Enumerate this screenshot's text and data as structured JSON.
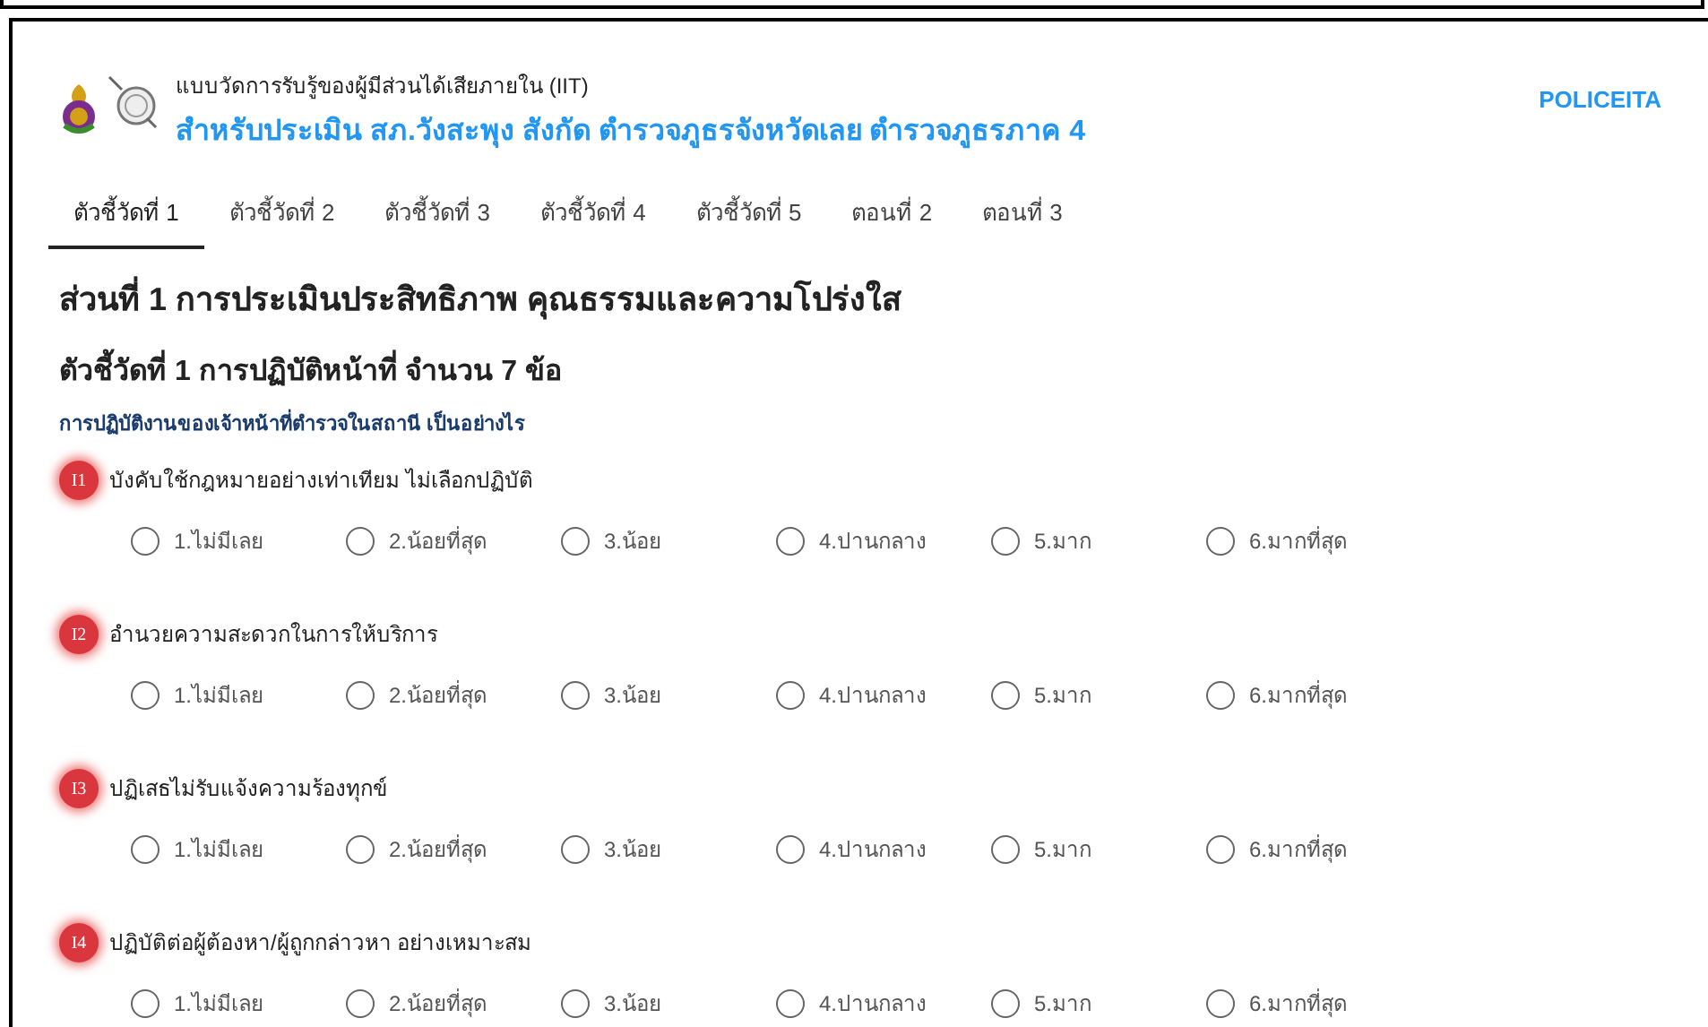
{
  "header": {
    "subtitle": "แบบวัดการรับรู้ของผู้มีส่วนได้เสียภายใน (IIT)",
    "title": "สำหรับประเมิน สภ.วังสะพุง สังกัด ตำรวจภูธรจังหวัดเลย ตำรวจภูธรภาค 4",
    "brand": "POLICEITA"
  },
  "tabs": [
    {
      "label": "ตัวชี้วัดที่ 1",
      "selected": true
    },
    {
      "label": "ตัวชี้วัดที่ 2",
      "selected": false
    },
    {
      "label": "ตัวชี้วัดที่ 3",
      "selected": false
    },
    {
      "label": "ตัวชี้วัดที่ 4",
      "selected": false
    },
    {
      "label": "ตัวชี้วัดที่ 5",
      "selected": false
    },
    {
      "label": "ตอนที่ 2",
      "selected": false
    },
    {
      "label": "ตอนที่ 3",
      "selected": false
    }
  ],
  "section_title": "ส่วนที่ 1 การประเมินประสิทธิภาพ คุณธรรมและความโปร่งใส",
  "indicator_title": "ตัวชี้วัดที่ 1 การปฏิบัติหน้าที่ จำนวน 7 ข้อ",
  "prompt": "การปฏิบัติงานของเจ้าหน้าที่ตำรวจในสถานี เป็นอย่างไร",
  "questions": [
    {
      "badge": "I1",
      "text": "บังคับใช้กฎหมายอย่างเท่าเทียม ไม่เลือกปฏิบัติ",
      "options": [
        {
          "label": "1.ไม่มีเลย",
          "selected": false
        },
        {
          "label": "2.น้อยที่สุด",
          "selected": false
        },
        {
          "label": "3.น้อย",
          "selected": false
        },
        {
          "label": "4.ปานกลาง",
          "selected": false
        },
        {
          "label": "5.มาก",
          "selected": false
        },
        {
          "label": "6.มากที่สุด",
          "selected": false
        }
      ]
    },
    {
      "badge": "I2",
      "text": "อำนวยความสะดวกในการให้บริการ",
      "options": [
        {
          "label": "1.ไม่มีเลย",
          "selected": false
        },
        {
          "label": "2.น้อยที่สุด",
          "selected": false
        },
        {
          "label": "3.น้อย",
          "selected": false
        },
        {
          "label": "4.ปานกลาง",
          "selected": false
        },
        {
          "label": "5.มาก",
          "selected": false
        },
        {
          "label": "6.มากที่สุด",
          "selected": false
        }
      ]
    },
    {
      "badge": "I3",
      "text": "ปฏิเสธไม่รับแจ้งความร้องทุกข์",
      "options": [
        {
          "label": "1.ไม่มีเลย",
          "selected": false
        },
        {
          "label": "2.น้อยที่สุด",
          "selected": false
        },
        {
          "label": "3.น้อย",
          "selected": false
        },
        {
          "label": "4.ปานกลาง",
          "selected": false
        },
        {
          "label": "5.มาก",
          "selected": false
        },
        {
          "label": "6.มากที่สุด",
          "selected": false
        }
      ]
    },
    {
      "badge": "I4",
      "text": "ปฏิบัติต่อผู้ต้องหา/ผู้ถูกกล่าวหา อย่างเหมาะสม",
      "options": [
        {
          "label": "1.ไม่มีเลย",
          "selected": false
        },
        {
          "label": "2.น้อยที่สุด",
          "selected": false
        },
        {
          "label": "3.น้อย",
          "selected": false
        },
        {
          "label": "4.ปานกลาง",
          "selected": false
        },
        {
          "label": "5.มาก",
          "selected": false
        },
        {
          "label": "6.มากที่สุด",
          "selected": false
        }
      ]
    }
  ]
}
